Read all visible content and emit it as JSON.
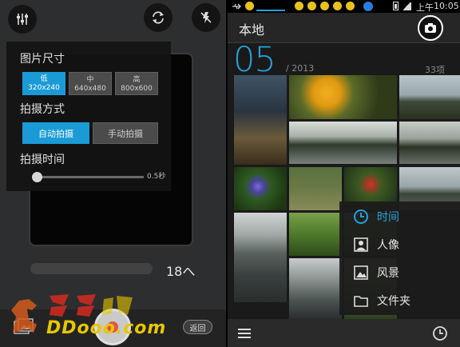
{
  "camera": {
    "size_title": "图片尺寸",
    "sizes": [
      {
        "name": "低",
        "res": "320x240",
        "selected": true
      },
      {
        "name": "中",
        "res": "640x480",
        "selected": false
      },
      {
        "name": "高",
        "res": "800x600",
        "selected": false
      }
    ],
    "mode_title": "拍摄方式",
    "modes": [
      {
        "label": "自动拍摄",
        "selected": true
      },
      {
        "label": "手动拍摄",
        "selected": false
      }
    ],
    "interval_title": "拍摄时间",
    "interval_value": "0.5秒",
    "counter": "18へ",
    "back_label": "返回",
    "toolbar_icons": [
      "equalizer-icon",
      "switch-camera-icon",
      "flash-off-icon"
    ]
  },
  "watermark": {
    "text": "DDooo.com",
    "chinese": "多多软件站"
  },
  "gallery": {
    "status": {
      "time_prefix": "上午",
      "time": "10:05",
      "notification_icons": [
        "usb-icon",
        "emoji-icon",
        "emoji-icon",
        "emoji-icon",
        "emoji-icon",
        "emoji-icon",
        "emoji-icon",
        "qq-icon"
      ]
    },
    "title": "本地",
    "month": "05",
    "year": "/ 2013",
    "count": "33项",
    "menu": [
      {
        "label": "时间",
        "icon": "clock-icon",
        "active": true
      },
      {
        "label": "人像",
        "icon": "portrait-icon",
        "active": false
      },
      {
        "label": "风景",
        "icon": "landscape-icon",
        "active": false
      },
      {
        "label": "文件夹",
        "icon": "folder-icon",
        "active": false
      }
    ],
    "accent": "#23a1dc"
  }
}
